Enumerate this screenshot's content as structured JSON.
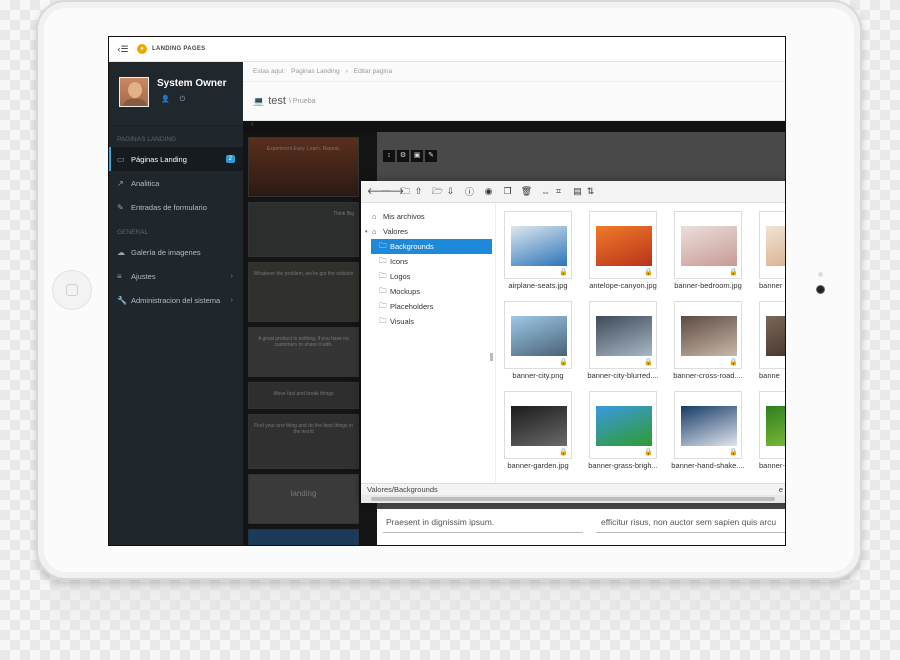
{
  "topbar": {
    "menu_icon": "menu-collapse-icon",
    "brand": "LANDING PAGES"
  },
  "profile": {
    "name": "System Owner"
  },
  "sidebar": {
    "section1": "PAGINAS LANDING",
    "section2": "GENERAL",
    "items": [
      {
        "label": "Páginas Landing",
        "icon": "laptop-icon",
        "badge": "2",
        "active": true
      },
      {
        "label": "Analitica",
        "icon": "chart-line-icon"
      },
      {
        "label": "Entradas de formulario",
        "icon": "edit-icon"
      },
      {
        "label": "Galería de imagenes",
        "icon": "cloud-icon"
      },
      {
        "label": "Ajustes",
        "icon": "sliders-icon",
        "chevron": "›"
      },
      {
        "label": "Administracion del sistema",
        "icon": "wrench-icon",
        "chevron": "›"
      }
    ]
  },
  "breadcrumb": {
    "item1": "Estas aqui:",
    "item2": "Paginas Landing",
    "sep": "›",
    "item3": "Editar pagina"
  },
  "page": {
    "title": "test",
    "subtitle": "\\ Prueba"
  },
  "editor": {
    "back": "‹",
    "thumbs": [
      "Experiment Easy. Learn. Repeat.",
      "Think Big",
      "Whatever the problem, we've got the solution",
      "A great product is nothing, if you have no customers to share it with.",
      "Move fast and break things",
      "Find your one thing and do the best things in the world",
      "landing"
    ],
    "bottom_left": "Praesent in dignissim ipsum.",
    "bottom_right": "efficitur risus, non auctor sem sapien quis arcu"
  },
  "file_manager": {
    "tree": [
      {
        "label": "Mis archivos",
        "level": 0,
        "icon": "home-icon"
      },
      {
        "label": "Valores",
        "level": 0,
        "icon": "home-icon"
      },
      {
        "label": "Backgrounds",
        "level": 1,
        "icon": "folder-open-icon",
        "selected": true
      },
      {
        "label": "Icons",
        "level": 1,
        "icon": "folder-icon"
      },
      {
        "label": "Logos",
        "level": 1,
        "icon": "folder-icon"
      },
      {
        "label": "Mockups",
        "level": 1,
        "icon": "folder-icon"
      },
      {
        "label": "Placeholders",
        "level": 1,
        "icon": "folder-icon"
      },
      {
        "label": "Visuals",
        "level": 1,
        "icon": "folder-icon"
      }
    ],
    "files": [
      {
        "name": "airplane-seats.jpg",
        "colors": [
          "#dfe7ee",
          "#2b74b9"
        ]
      },
      {
        "name": "antelope-canyon.jpg",
        "colors": [
          "#f07a2a",
          "#b8341a"
        ]
      },
      {
        "name": "banner-bedroom.jpg",
        "colors": [
          "#eadfdc",
          "#c99a94"
        ]
      },
      {
        "name": "banner",
        "colors": [
          "#f2e2d4",
          "#d4a883"
        ]
      },
      {
        "name": "banner-city.png",
        "colors": [
          "#9ec8e6",
          "#4a6277"
        ]
      },
      {
        "name": "banner-city-blurred....",
        "colors": [
          "#3e4a59",
          "#a8b7c6"
        ]
      },
      {
        "name": "banner-cross-road....",
        "colors": [
          "#5b4a42",
          "#c9b9a9"
        ]
      },
      {
        "name": "banne",
        "colors": [
          "#7b6656",
          "#3b2e26"
        ]
      },
      {
        "name": "banner-garden.jpg",
        "colors": [
          "#1b1b1b",
          "#6a6a6a"
        ]
      },
      {
        "name": "banner-grass-brigh...",
        "colors": [
          "#3a9ae0",
          "#2f9b2f"
        ]
      },
      {
        "name": "banner-hand-shake....",
        "colors": [
          "#163a66",
          "#e0e6ee"
        ]
      },
      {
        "name": "banner-",
        "colors": [
          "#2f7f1f",
          "#8cc63f"
        ]
      }
    ],
    "status": "Valores/Backgrounds",
    "status_right": "e"
  }
}
